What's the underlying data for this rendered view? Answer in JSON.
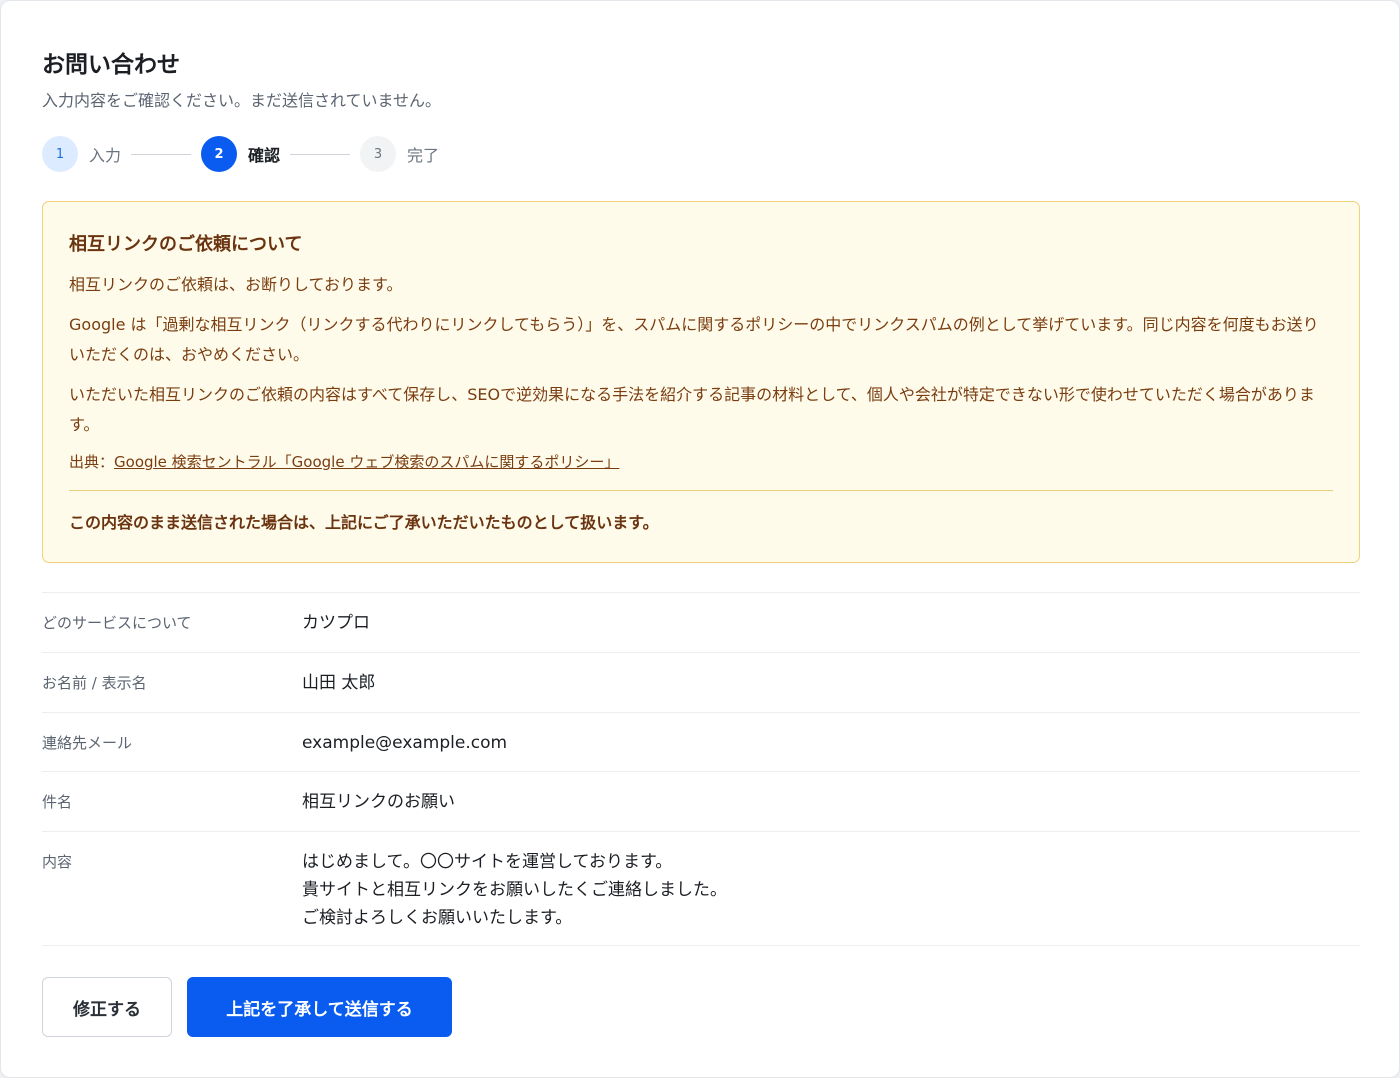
{
  "header": {
    "title": "お問い合わせ",
    "subtitle": "入力内容をご確認ください。まだ送信されていません。"
  },
  "stepper": {
    "steps": [
      {
        "number": "1",
        "label": "入力",
        "state": "done"
      },
      {
        "number": "2",
        "label": "確認",
        "state": "active"
      },
      {
        "number": "3",
        "label": "完了",
        "state": "todo"
      }
    ]
  },
  "notice": {
    "title": "相互リンクのご依頼について",
    "p1": "相互リンクのご依頼は、お断りしております。",
    "p2": "Google は「過剰な相互リンク（リンクする代わりにリンクしてもらう）」を、スパムに関するポリシーの中でリンクスパムの例として挙げています。同じ内容を何度もお送りいただくのは、おやめください。",
    "p3": "いただいた相互リンクのご依頼の内容はすべて保存し、SEOで逆効果になる手法を紹介する記事の材料として、個人や会社が特定できない形で使わせていただく場合があります。",
    "source_prefix": "出典：",
    "source_link": "Google 検索セントラル「Google ウェブ検索のスパムに関するポリシー」",
    "confirm": "この内容のまま送信された場合は、上記にご了承いただいたものとして扱います。"
  },
  "review": {
    "rows": [
      {
        "label": "どのサービスについて",
        "value": "カツプロ"
      },
      {
        "label": "お名前 / 表示名",
        "value": "山田 太郎"
      },
      {
        "label": "連絡先メール",
        "value": "example@example.com"
      },
      {
        "label": "件名",
        "value": "相互リンクのお願い"
      },
      {
        "label": "内容",
        "value": "はじめまして。〇〇サイトを運営しております。\n貴サイトと相互リンクをお願いしたくご連絡しました。\nご検討よろしくお願いいたします。"
      }
    ]
  },
  "actions": {
    "edit_label": "修正する",
    "submit_label": "上記を了承して送信する"
  },
  "colors": {
    "primary": "#0a5cf0",
    "notice_bg": "#fffbeb",
    "notice_border": "#f0d27a",
    "notice_text": "#7a3d10"
  }
}
